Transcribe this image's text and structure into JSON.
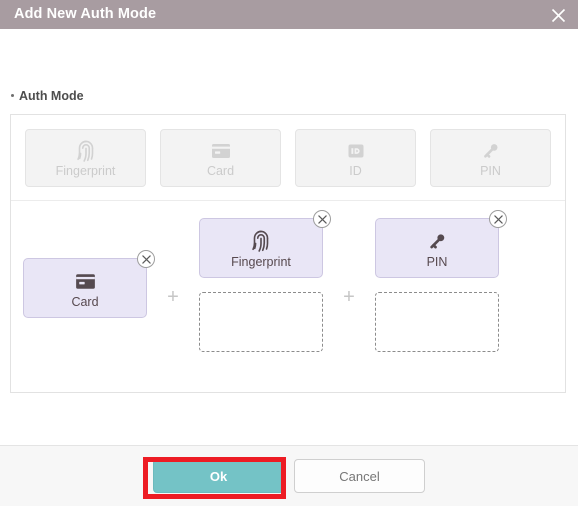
{
  "window": {
    "title": "Add New Auth Mode",
    "close_icon": "close-icon",
    "header_color": "#a89ca1"
  },
  "form": {
    "section_label": "Auth Mode"
  },
  "palette": {
    "options": [
      {
        "label": "Fingerprint",
        "icon": "fingerprint-icon",
        "enabled": false
      },
      {
        "label": "Card",
        "icon": "card-icon",
        "enabled": false
      },
      {
        "label": "ID",
        "icon": "id-badge-icon",
        "enabled": false
      },
      {
        "label": "PIN",
        "icon": "key-icon",
        "enabled": false
      }
    ]
  },
  "builder": {
    "separator": "+",
    "slots": [
      {
        "label": "Card",
        "icon": "card-icon",
        "remove_icon": "remove-circle-icon",
        "has_dropzone": false
      },
      {
        "label": "Fingerprint",
        "icon": "fingerprint-icon",
        "remove_icon": "remove-circle-icon",
        "has_dropzone": true
      },
      {
        "label": "PIN",
        "icon": "key-icon",
        "remove_icon": "remove-circle-icon",
        "has_dropzone": true
      }
    ]
  },
  "footer": {
    "ok_label": "Ok",
    "cancel_label": "Cancel",
    "ok_color": "#74c3c6",
    "highlight_color": "#ed1c24"
  }
}
